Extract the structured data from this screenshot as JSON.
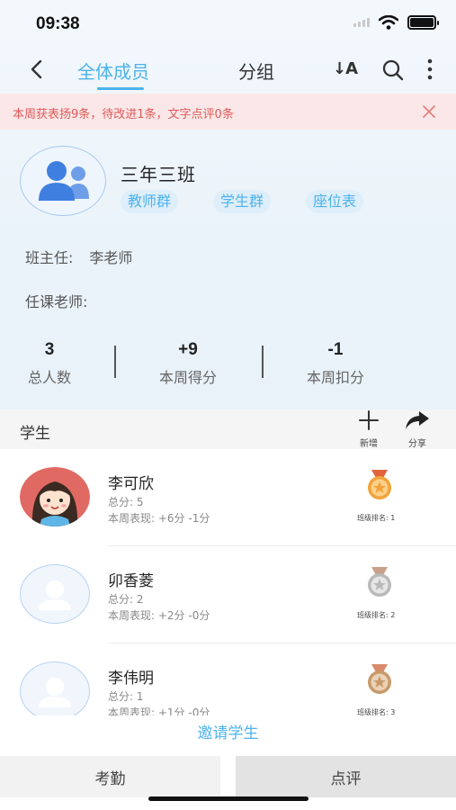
{
  "status_bar": {
    "time": "09:38"
  },
  "nav": {
    "tab_all": "全体成员",
    "tab_group": "分组",
    "sort_label": "↓A"
  },
  "banner": {
    "text": "本周获表扬9条，待改进1条，文字点评0条"
  },
  "class_info": {
    "name": "三年三班",
    "chips": [
      "教师群",
      "学生群",
      "座位表"
    ],
    "head_teacher_label": "班主任:",
    "head_teacher_value": "李老师",
    "subject_teacher_label": "任课老师:"
  },
  "stats": [
    {
      "value": "3",
      "label": "总人数"
    },
    {
      "value": "+9",
      "label": "本周得分"
    },
    {
      "value": "-1",
      "label": "本周扣分"
    }
  ],
  "students_section": {
    "title": "学生",
    "add_label": "新增",
    "share_label": "分享"
  },
  "students": [
    {
      "name": "李可欣",
      "total": "总分: 5",
      "week": "本周表现: +6分 -1分",
      "rank": "班级排名: 1",
      "medal": "gold",
      "avatar": "girl"
    },
    {
      "name": "卯香菱",
      "total": "总分: 2",
      "week": "本周表现: +2分 -0分",
      "rank": "班级排名: 2",
      "medal": "silver",
      "avatar": "placeholder"
    },
    {
      "name": "李伟明",
      "total": "总分: 1",
      "week": "本周表现: +1分 -0分",
      "rank": "班级排名: 3",
      "medal": "bronze",
      "avatar": "placeholder"
    }
  ],
  "colors": {
    "accent": "#4cb3ec",
    "banner_text": "#e05a5a",
    "gold": "#f2a33a",
    "silver": "#b9b9b9",
    "bronze": "#c89a6a"
  },
  "footer": {
    "invite_label": "邀请学生",
    "attendance_label": "考勤",
    "comment_label": "点评"
  }
}
